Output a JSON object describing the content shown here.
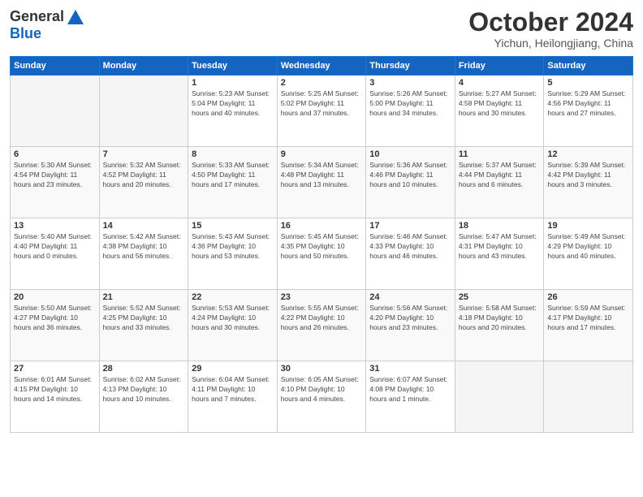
{
  "header": {
    "logo": {
      "general": "General",
      "blue": "Blue"
    },
    "title": "October 2024",
    "subtitle": "Yichun, Heilongjiang, China"
  },
  "days_of_week": [
    "Sunday",
    "Monday",
    "Tuesday",
    "Wednesday",
    "Thursday",
    "Friday",
    "Saturday"
  ],
  "weeks": [
    [
      {
        "day": "",
        "info": ""
      },
      {
        "day": "",
        "info": ""
      },
      {
        "day": "1",
        "info": "Sunrise: 5:23 AM\nSunset: 5:04 PM\nDaylight: 11 hours and 40 minutes."
      },
      {
        "day": "2",
        "info": "Sunrise: 5:25 AM\nSunset: 5:02 PM\nDaylight: 11 hours and 37 minutes."
      },
      {
        "day": "3",
        "info": "Sunrise: 5:26 AM\nSunset: 5:00 PM\nDaylight: 11 hours and 34 minutes."
      },
      {
        "day": "4",
        "info": "Sunrise: 5:27 AM\nSunset: 4:58 PM\nDaylight: 11 hours and 30 minutes."
      },
      {
        "day": "5",
        "info": "Sunrise: 5:29 AM\nSunset: 4:56 PM\nDaylight: 11 hours and 27 minutes."
      }
    ],
    [
      {
        "day": "6",
        "info": "Sunrise: 5:30 AM\nSunset: 4:54 PM\nDaylight: 11 hours and 23 minutes."
      },
      {
        "day": "7",
        "info": "Sunrise: 5:32 AM\nSunset: 4:52 PM\nDaylight: 11 hours and 20 minutes."
      },
      {
        "day": "8",
        "info": "Sunrise: 5:33 AM\nSunset: 4:50 PM\nDaylight: 11 hours and 17 minutes."
      },
      {
        "day": "9",
        "info": "Sunrise: 5:34 AM\nSunset: 4:48 PM\nDaylight: 11 hours and 13 minutes."
      },
      {
        "day": "10",
        "info": "Sunrise: 5:36 AM\nSunset: 4:46 PM\nDaylight: 11 hours and 10 minutes."
      },
      {
        "day": "11",
        "info": "Sunrise: 5:37 AM\nSunset: 4:44 PM\nDaylight: 11 hours and 6 minutes."
      },
      {
        "day": "12",
        "info": "Sunrise: 5:39 AM\nSunset: 4:42 PM\nDaylight: 11 hours and 3 minutes."
      }
    ],
    [
      {
        "day": "13",
        "info": "Sunrise: 5:40 AM\nSunset: 4:40 PM\nDaylight: 11 hours and 0 minutes."
      },
      {
        "day": "14",
        "info": "Sunrise: 5:42 AM\nSunset: 4:38 PM\nDaylight: 10 hours and 56 minutes."
      },
      {
        "day": "15",
        "info": "Sunrise: 5:43 AM\nSunset: 4:36 PM\nDaylight: 10 hours and 53 minutes."
      },
      {
        "day": "16",
        "info": "Sunrise: 5:45 AM\nSunset: 4:35 PM\nDaylight: 10 hours and 50 minutes."
      },
      {
        "day": "17",
        "info": "Sunrise: 5:46 AM\nSunset: 4:33 PM\nDaylight: 10 hours and 46 minutes."
      },
      {
        "day": "18",
        "info": "Sunrise: 5:47 AM\nSunset: 4:31 PM\nDaylight: 10 hours and 43 minutes."
      },
      {
        "day": "19",
        "info": "Sunrise: 5:49 AM\nSunset: 4:29 PM\nDaylight: 10 hours and 40 minutes."
      }
    ],
    [
      {
        "day": "20",
        "info": "Sunrise: 5:50 AM\nSunset: 4:27 PM\nDaylight: 10 hours and 36 minutes."
      },
      {
        "day": "21",
        "info": "Sunrise: 5:52 AM\nSunset: 4:25 PM\nDaylight: 10 hours and 33 minutes."
      },
      {
        "day": "22",
        "info": "Sunrise: 5:53 AM\nSunset: 4:24 PM\nDaylight: 10 hours and 30 minutes."
      },
      {
        "day": "23",
        "info": "Sunrise: 5:55 AM\nSunset: 4:22 PM\nDaylight: 10 hours and 26 minutes."
      },
      {
        "day": "24",
        "info": "Sunrise: 5:56 AM\nSunset: 4:20 PM\nDaylight: 10 hours and 23 minutes."
      },
      {
        "day": "25",
        "info": "Sunrise: 5:58 AM\nSunset: 4:18 PM\nDaylight: 10 hours and 20 minutes."
      },
      {
        "day": "26",
        "info": "Sunrise: 5:59 AM\nSunset: 4:17 PM\nDaylight: 10 hours and 17 minutes."
      }
    ],
    [
      {
        "day": "27",
        "info": "Sunrise: 6:01 AM\nSunset: 4:15 PM\nDaylight: 10 hours and 14 minutes."
      },
      {
        "day": "28",
        "info": "Sunrise: 6:02 AM\nSunset: 4:13 PM\nDaylight: 10 hours and 10 minutes."
      },
      {
        "day": "29",
        "info": "Sunrise: 6:04 AM\nSunset: 4:11 PM\nDaylight: 10 hours and 7 minutes."
      },
      {
        "day": "30",
        "info": "Sunrise: 6:05 AM\nSunset: 4:10 PM\nDaylight: 10 hours and 4 minutes."
      },
      {
        "day": "31",
        "info": "Sunrise: 6:07 AM\nSunset: 4:08 PM\nDaylight: 10 hours and 1 minute."
      },
      {
        "day": "",
        "info": ""
      },
      {
        "day": "",
        "info": ""
      }
    ]
  ]
}
